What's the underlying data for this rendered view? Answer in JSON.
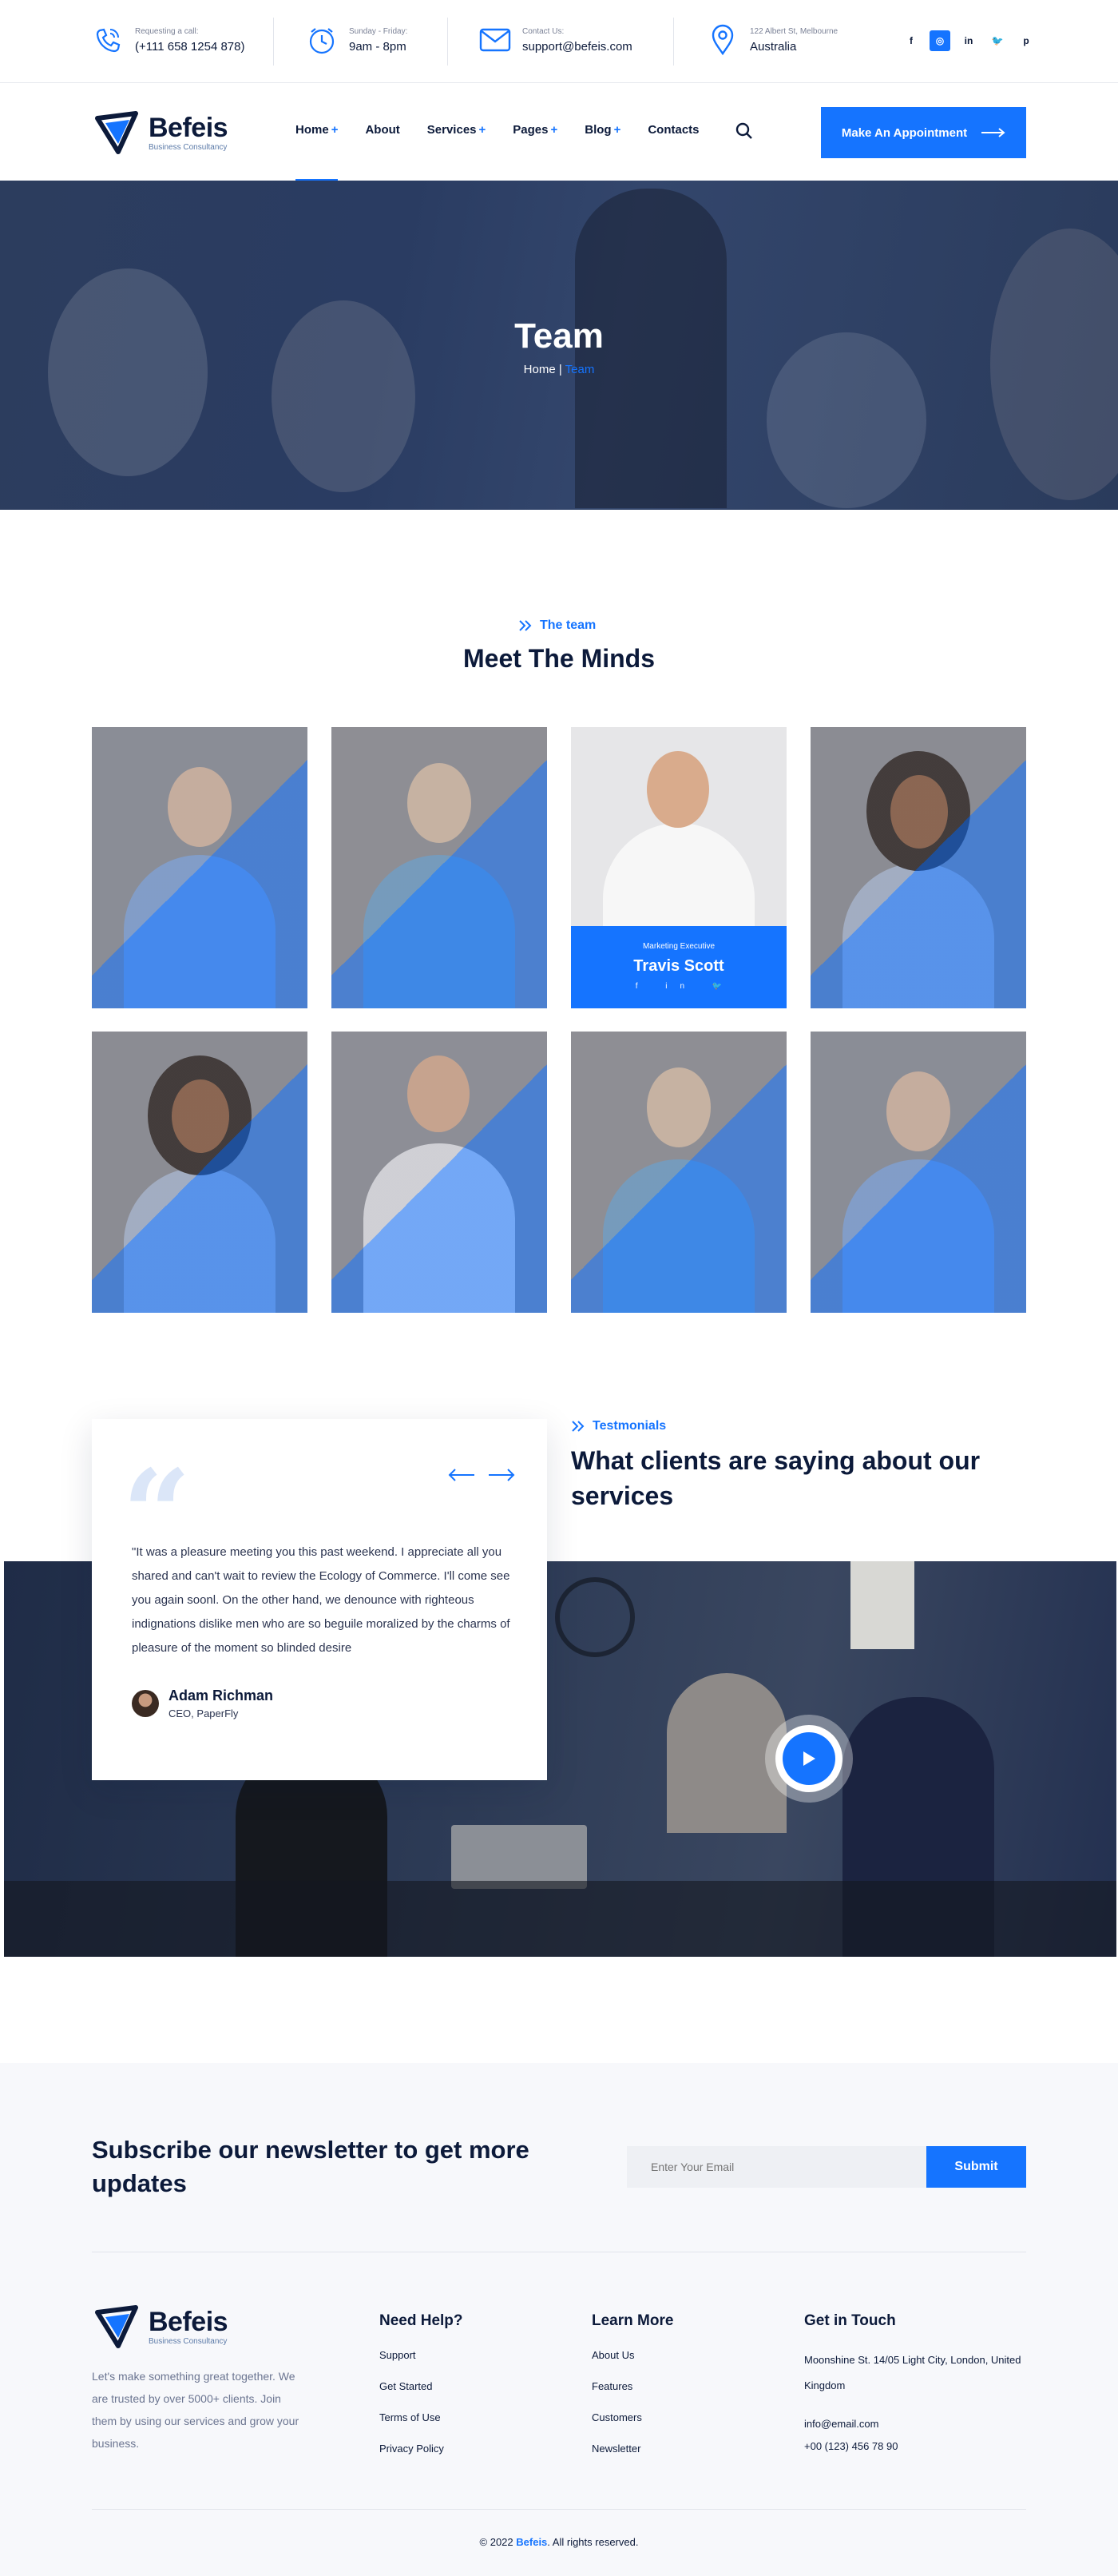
{
  "topbar": {
    "call": {
      "small": "Requesting a call:",
      "value": "(+111 658 1254 878)"
    },
    "hours": {
      "small": "Sunday - Friday:",
      "value": "9am - 8pm"
    },
    "contact": {
      "small": "Contact Us:",
      "value": "support@befeis.com"
    },
    "location": {
      "small": "122 Albert St, Melbourne",
      "value": "Australia"
    },
    "socials": [
      "f",
      "◎",
      "in",
      "🐦",
      "p"
    ]
  },
  "brand": {
    "name": "Befeis",
    "tagline": "Business Consultancy"
  },
  "nav": {
    "items": [
      {
        "label": "Home",
        "plus": "+"
      },
      {
        "label": "About",
        "plus": ""
      },
      {
        "label": "Services",
        "plus": "+"
      },
      {
        "label": "Pages",
        "plus": "+"
      },
      {
        "label": "Blog",
        "plus": "+"
      },
      {
        "label": "Contacts",
        "plus": ""
      }
    ],
    "cta": "Make An Appointment"
  },
  "hero": {
    "title": "Team",
    "crumb_home": "Home",
    "crumb_sep": " | ",
    "crumb_current": "Team"
  },
  "team": {
    "eyebrow": "The team",
    "title": "Meet The Minds",
    "featured": {
      "role": "Marketing Executive",
      "name": "Travis Scott",
      "socials": "f in 🐦"
    }
  },
  "testimonials": {
    "eyebrow": "Testmonials",
    "title": "What clients are saying about our services",
    "quote": "\"It was a pleasure meeting you this past weekend. I appreciate all you shared and can't wait to review the Ecology of Commerce. I'll come see you again soonl. On the other hand, we denounce with righteous indignations dislike men who are so beguile moralized by the charms of pleasure of the moment so blinded desire",
    "author": "Adam Richman",
    "author_role": "CEO, PaperFly"
  },
  "newsletter": {
    "title": "Subscribe our newsletter to get more updates",
    "placeholder": "Enter Your Email",
    "submit": "Submit"
  },
  "footer": {
    "about": "Let's make something great together. We are trusted by over 5000+ clients. Join them by using our services and grow your business.",
    "help": {
      "title": "Need Help?",
      "links": [
        "Support",
        "Get Started",
        "Terms of Use",
        "Privacy Policy"
      ]
    },
    "learn": {
      "title": "Learn More",
      "links": [
        "About Us",
        "Features",
        "Customers",
        "Newsletter"
      ]
    },
    "touch": {
      "title": "Get in Touch",
      "address": "Moonshine St. 14/05 Light City, London, United Kingdom",
      "email": "info@email.com",
      "phone": "+00 (123) 456 78 90"
    },
    "copyright_pre": "© 2022 ",
    "copyright_brand": "Befeis",
    "copyright_post": ". All rights reserved."
  },
  "colors": {
    "accent": "#1574ff",
    "dark": "#0c1a3a",
    "footer_bg": "#f7f8fb"
  }
}
